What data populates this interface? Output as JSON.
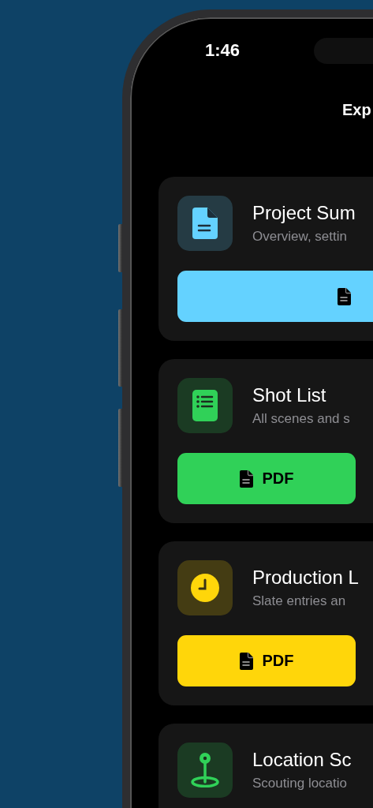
{
  "status_bar": {
    "time": "1:46"
  },
  "nav": {
    "title": "Exp"
  },
  "cards": [
    {
      "kind": "document",
      "color": "#64d2ff",
      "title": "Project Sum",
      "subtitle": "Overview, settin",
      "button": {
        "kind": "wide"
      }
    },
    {
      "kind": "list",
      "color": "#30d158",
      "title": "Shot List",
      "subtitle": "All scenes and s",
      "button": {
        "kind": "split",
        "label": "PDF"
      }
    },
    {
      "kind": "clock",
      "color": "#ffd60a",
      "title": "Production L",
      "subtitle": "Slate entries an",
      "button": {
        "kind": "split",
        "label": "PDF"
      }
    },
    {
      "kind": "pin",
      "color": "#30d158",
      "title": "Location Sc",
      "subtitle": "Scouting locatio"
    }
  ]
}
